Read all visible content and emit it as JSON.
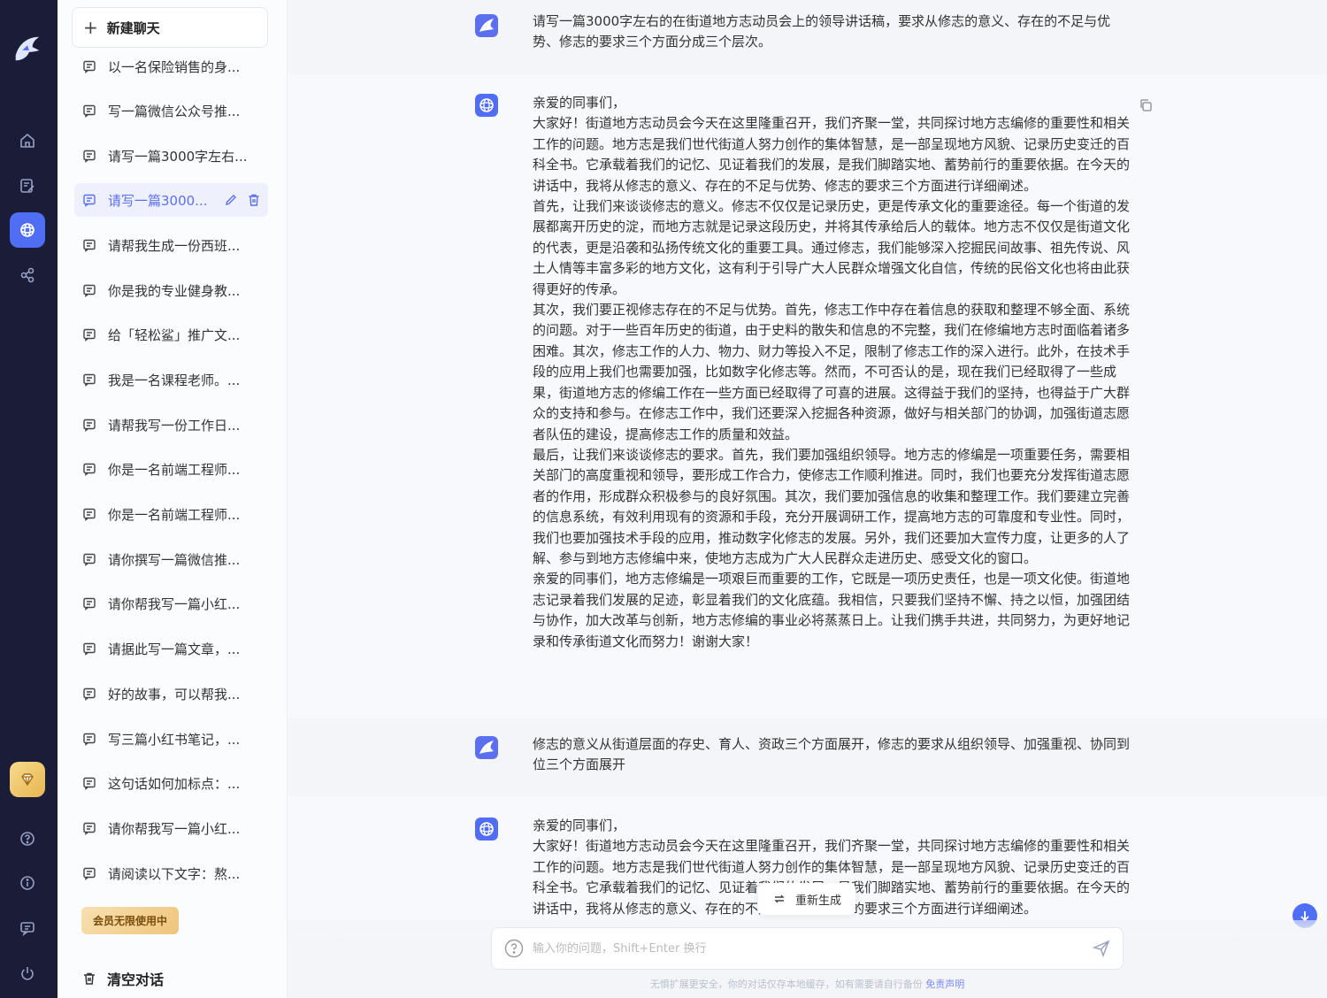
{
  "colors": {
    "rail": "#1a1c38",
    "accent": "#4f6df5",
    "active_item_bg": "#eef1fd",
    "active_item_text": "#5b6ff0"
  },
  "rail": {
    "logo_icon": "shark-logo-icon",
    "items": [
      {
        "name": "home-icon"
      },
      {
        "name": "notes-icon"
      },
      {
        "name": "chat-icon",
        "active": true
      },
      {
        "name": "apps-icon"
      }
    ],
    "bottom": [
      {
        "name": "vip-diamond-icon"
      },
      {
        "name": "help-icon"
      },
      {
        "name": "info-icon"
      },
      {
        "name": "feedback-icon"
      },
      {
        "name": "power-icon"
      }
    ]
  },
  "sidebar": {
    "new_chat_label": "新建聊天",
    "history": [
      {
        "title": "以一名保险销售的身..."
      },
      {
        "title": "写一篇微信公众号推..."
      },
      {
        "title": "请写一篇3000字左右..."
      },
      {
        "title": "请写一篇3000...",
        "active": true
      },
      {
        "title": "请帮我生成一份西班..."
      },
      {
        "title": "你是我的专业健身教..."
      },
      {
        "title": "给「轻松鲨」推广文..."
      },
      {
        "title": "我是一名课程老师。..."
      },
      {
        "title": "请帮我写一份工作日..."
      },
      {
        "title": "你是一名前端工程师..."
      },
      {
        "title": "你是一名前端工程师..."
      },
      {
        "title": "请你撰写一篇微信推..."
      },
      {
        "title": "请你帮我写一篇小红..."
      },
      {
        "title": "请据此写一篇文章，..."
      },
      {
        "title": "好的故事，可以帮我..."
      },
      {
        "title": "写三篇小红书笔记，..."
      },
      {
        "title": "这句话如何加标点：..."
      },
      {
        "title": "请你帮我写一篇小红..."
      },
      {
        "title": "请阅读以下文字：熬..."
      }
    ],
    "member_badge": "会员无限使用中",
    "clear_label": "清空对话"
  },
  "chat": {
    "messages": [
      {
        "role": "user",
        "lines": [
          "请写一篇3000字左右的在街道地方志动员会上的领导讲话稿，要求从修志的意义、存在的不足与优势、修志的要求三个方面分成三个层次。"
        ]
      },
      {
        "role": "assistant",
        "lines": [
          "亲爱的同事们，",
          "大家好！街道地方志动员会今天在这里隆重召开，我们齐聚一堂，共同探讨地方志编修的重要性和相关工作的问题。地方志是我们世代街道人努力创作的集体智慧，是一部呈现地方风貌、记录历史变迁的百科全书。它承载着我们的记忆、见证着我们的发展，是我们脚踏实地、蓄势前行的重要依据。在今天的讲话中，我将从修志的意义、存在的不足与优势、修志的要求三个方面进行详细阐述。",
          "首先，让我们来谈谈修志的意义。修志不仅仅是记录历史，更是传承文化的重要途径。每一个街道的发展都离开历史的淀，而地方志就是记录这段历史，并将其传承给后人的载体。地方志不仅仅是街道文化的代表，更是沿袭和弘扬传统文化的重要工具。通过修志，我们能够深入挖掘民间故事、祖先传说、风土人情等丰富多彩的地方文化，这有利于引导广大人民群众增强文化自信，传统的民俗文化也将由此获得更好的传承。",
          "其次，我们要正视修志存在的不足与优势。首先，修志工作中存在着信息的获取和整理不够全面、系统的问题。对于一些百年历史的街道，由于史料的散失和信息的不完整，我们在修编地方志时面临着诸多困难。其次，修志工作的人力、物力、财力等投入不足，限制了修志工作的深入进行。此外，在技术手段的应用上我们也需要加强，比如数字化修志等。然而，不可否认的是，现在我们已经取得了一些成果，街道地方志的修编工作在一些方面已经取得了可喜的进展。这得益于我们的坚持，也得益于广大群众的支持和参与。在修志工作中，我们还要深入挖掘各种资源，做好与相关部门的协调，加强街道志愿者队伍的建设，提高修志工作的质量和效益。",
          "最后，让我们来谈谈修志的要求。首先，我们要加强组织领导。地方志的修编是一项重要任务，需要相关部门的高度重视和领导，要形成工作合力，使修志工作顺利推进。同时，我们也要充分发挥街道志愿者的作用，形成群众积极参与的良好氛围。其次，我们要加强信息的收集和整理工作。我们要建立完善的信息系统，有效利用现有的资源和手段，充分开展调研工作，提高地方志的可靠度和专业性。同时，我们也要加强技术手段的应用，推动数字化修志的发展。另外，我们还要加大宣传力度，让更多的人了解、参与到地方志修编中来，使地方志成为广大人民群众走进历史、感受文化的窗口。",
          "亲爱的同事们，地方志修编是一项艰巨而重要的工作，它既是一项历史责任，也是一项文化使。街道地志记录着我们发展的足迹，彰显着我们的文化底蕴。我相信，只要我们坚持不懈、持之以恒，加强团结与协作，加大改革与创新，地方志修编的事业必将蒸蒸日上。让我们携手共进，共同努力，为更好地记录和传承街道文化而努力！谢谢大家！"
        ]
      },
      {
        "role": "user",
        "lines": [
          "修志的意义从街道层面的存史、育人、资政三个方面展开，修志的要求从组织领导、加强重视、协同到位三个方面展开"
        ]
      },
      {
        "role": "assistant",
        "lines": [
          "亲爱的同事们，",
          "大家好！街道地方志动员会今天在这里隆重召开，我们齐聚一堂，共同探讨地方志编修的重要性和相关工作的问题。地方志是我们世代街道人努力创作的集体智慧，是一部呈现地方风貌、记录历史变迁的百科全书。它承载着我们的记忆、见证着我们的发展，是我们脚踏实地、蓄势前行的重要依据。在今天的讲话中，我将从修志的意义、存在的不足与优势、修志的要求三个方面进行详细阐述。"
        ]
      }
    ],
    "regenerate_label": "重新生成",
    "input_placeholder": "输入你的问题，Shift+Enter 换行",
    "disclaimer": "无惧扩展更安全，你的对话仅存本地缓存，如有需要请自行备份",
    "disclaimer_link": "免责声明"
  }
}
